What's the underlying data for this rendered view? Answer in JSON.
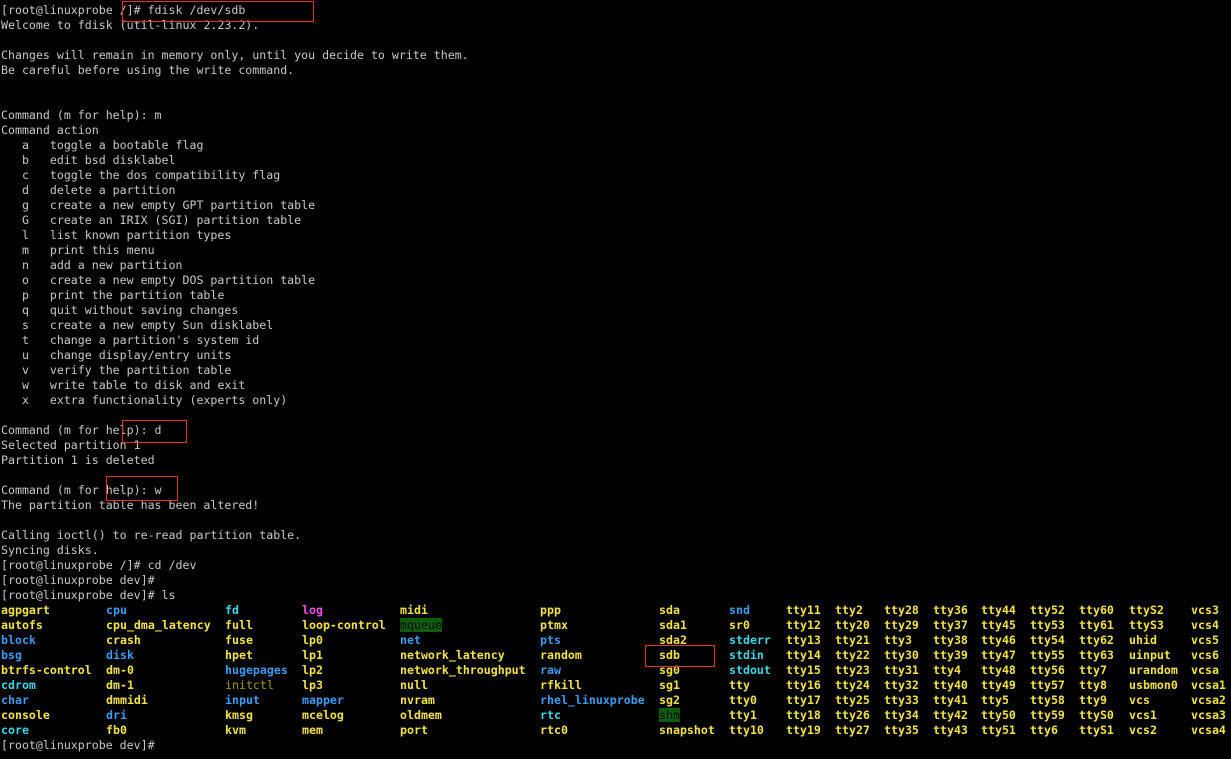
{
  "terminal": {
    "lines": [
      "[root@linuxprobe /]# fdisk /dev/sdb",
      "Welcome to fdisk (util-linux 2.23.2).",
      "",
      "Changes will remain in memory only, until you decide to write them.",
      "Be careful before using the write command.",
      "",
      "",
      "Command (m for help): m",
      "Command action",
      "   a   toggle a bootable flag",
      "   b   edit bsd disklabel",
      "   c   toggle the dos compatibility flag",
      "   d   delete a partition",
      "   g   create a new empty GPT partition table",
      "   G   create an IRIX (SGI) partition table",
      "   l   list known partition types",
      "   m   print this menu",
      "   n   add a new partition",
      "   o   create a new empty DOS partition table",
      "   p   print the partition table",
      "   q   quit without saving changes",
      "   s   create a new empty Sun disklabel",
      "   t   change a partition's system id",
      "   u   change display/entry units",
      "   v   verify the partition table",
      "   w   write table to disk and exit",
      "   x   extra functionality (experts only)",
      "",
      "Command (m for help): d",
      "Selected partition 1",
      "Partition 1 is deleted",
      "",
      "Command (m for help): w",
      "The partition table has been altered!",
      "",
      "Calling ioctl() to re-read partition table.",
      "Syncing disks.",
      "[root@linuxprobe /]# cd /dev",
      "[root@linuxprobe dev]#",
      "[root@linuxprobe dev]# ls"
    ],
    "final_prompt": "[root@linuxprobe dev]#",
    "ls_columns": [
      [
        [
          "agpgart",
          "dev"
        ],
        [
          "autofs",
          "dev"
        ],
        [
          "block",
          "dir"
        ],
        [
          "bsg",
          "dir"
        ],
        [
          "btrfs-control",
          "dev"
        ],
        [
          "cdrom",
          "link"
        ],
        [
          "char",
          "dir"
        ],
        [
          "console",
          "dev"
        ],
        [
          "core",
          "link"
        ]
      ],
      [
        [
          "cpu",
          "dir"
        ],
        [
          "cpu_dma_latency",
          "dev"
        ],
        [
          "crash",
          "dev"
        ],
        [
          "disk",
          "dir"
        ],
        [
          "dm-0",
          "dev"
        ],
        [
          "dm-1",
          "dev"
        ],
        [
          "dmmidi",
          "dev"
        ],
        [
          "dri",
          "dir"
        ],
        [
          "fb0",
          "dev"
        ]
      ],
      [
        [
          "fd",
          "link"
        ],
        [
          "full",
          "dev"
        ],
        [
          "fuse",
          "dev"
        ],
        [
          "hpet",
          "dev"
        ],
        [
          "hugepages",
          "dir"
        ],
        [
          "initctl",
          "pipe"
        ],
        [
          "input",
          "dir"
        ],
        [
          "kmsg",
          "dev"
        ],
        [
          "kvm",
          "dev"
        ]
      ],
      [
        [
          "log",
          "sock"
        ],
        [
          "loop-control",
          "dev"
        ],
        [
          "lp0",
          "dev"
        ],
        [
          "lp1",
          "dev"
        ],
        [
          "lp2",
          "dev"
        ],
        [
          "lp3",
          "dev"
        ],
        [
          "mapper",
          "dir"
        ],
        [
          "mcelog",
          "dev"
        ],
        [
          "mem",
          "dev"
        ]
      ],
      [
        [
          "midi",
          "dev"
        ],
        [
          "mqueue",
          "sticky"
        ],
        [
          "net",
          "dir"
        ],
        [
          "network_latency",
          "dev"
        ],
        [
          "network_throughput",
          "dev"
        ],
        [
          "null",
          "dev"
        ],
        [
          "nvram",
          "dev"
        ],
        [
          "oldmem",
          "dev"
        ],
        [
          "port",
          "dev"
        ]
      ],
      [
        [
          "ppp",
          "dev"
        ],
        [
          "ptmx",
          "dev"
        ],
        [
          "pts",
          "dir"
        ],
        [
          "random",
          "dev"
        ],
        [
          "raw",
          "dir"
        ],
        [
          "rfkill",
          "dev"
        ],
        [
          "rhel_linuxprobe",
          "dir"
        ],
        [
          "rtc",
          "link"
        ],
        [
          "rtc0",
          "dev"
        ]
      ],
      [
        [
          "sda",
          "dev"
        ],
        [
          "sda1",
          "dev"
        ],
        [
          "sda2",
          "dev"
        ],
        [
          "sdb",
          "dev"
        ],
        [
          "sg0",
          "dev"
        ],
        [
          "sg1",
          "dev"
        ],
        [
          "sg2",
          "dev"
        ],
        [
          "shm",
          "sticky"
        ],
        [
          "snapshot",
          "dev"
        ]
      ],
      [
        [
          "snd",
          "dir"
        ],
        [
          "sr0",
          "dev"
        ],
        [
          "stderr",
          "link"
        ],
        [
          "stdin",
          "link"
        ],
        [
          "stdout",
          "link"
        ],
        [
          "tty",
          "dev"
        ],
        [
          "tty0",
          "dev"
        ],
        [
          "tty1",
          "dev"
        ],
        [
          "tty10",
          "dev"
        ]
      ],
      [
        [
          "tty11",
          "dev"
        ],
        [
          "tty12",
          "dev"
        ],
        [
          "tty13",
          "dev"
        ],
        [
          "tty14",
          "dev"
        ],
        [
          "tty15",
          "dev"
        ],
        [
          "tty16",
          "dev"
        ],
        [
          "tty17",
          "dev"
        ],
        [
          "tty18",
          "dev"
        ],
        [
          "tty19",
          "dev"
        ]
      ],
      [
        [
          "tty2",
          "dev"
        ],
        [
          "tty20",
          "dev"
        ],
        [
          "tty21",
          "dev"
        ],
        [
          "tty22",
          "dev"
        ],
        [
          "tty23",
          "dev"
        ],
        [
          "tty24",
          "dev"
        ],
        [
          "tty25",
          "dev"
        ],
        [
          "tty26",
          "dev"
        ],
        [
          "tty27",
          "dev"
        ]
      ],
      [
        [
          "tty28",
          "dev"
        ],
        [
          "tty29",
          "dev"
        ],
        [
          "tty3",
          "dev"
        ],
        [
          "tty30",
          "dev"
        ],
        [
          "tty31",
          "dev"
        ],
        [
          "tty32",
          "dev"
        ],
        [
          "tty33",
          "dev"
        ],
        [
          "tty34",
          "dev"
        ],
        [
          "tty35",
          "dev"
        ]
      ],
      [
        [
          "tty36",
          "dev"
        ],
        [
          "tty37",
          "dev"
        ],
        [
          "tty38",
          "dev"
        ],
        [
          "tty39",
          "dev"
        ],
        [
          "tty4",
          "dev"
        ],
        [
          "tty40",
          "dev"
        ],
        [
          "tty41",
          "dev"
        ],
        [
          "tty42",
          "dev"
        ],
        [
          "tty43",
          "dev"
        ]
      ],
      [
        [
          "tty44",
          "dev"
        ],
        [
          "tty45",
          "dev"
        ],
        [
          "tty46",
          "dev"
        ],
        [
          "tty47",
          "dev"
        ],
        [
          "tty48",
          "dev"
        ],
        [
          "tty49",
          "dev"
        ],
        [
          "tty5",
          "dev"
        ],
        [
          "tty50",
          "dev"
        ],
        [
          "tty51",
          "dev"
        ]
      ],
      [
        [
          "tty52",
          "dev"
        ],
        [
          "tty53",
          "dev"
        ],
        [
          "tty54",
          "dev"
        ],
        [
          "tty55",
          "dev"
        ],
        [
          "tty56",
          "dev"
        ],
        [
          "tty57",
          "dev"
        ],
        [
          "tty58",
          "dev"
        ],
        [
          "tty59",
          "dev"
        ],
        [
          "tty6",
          "dev"
        ]
      ],
      [
        [
          "tty60",
          "dev"
        ],
        [
          "tty61",
          "dev"
        ],
        [
          "tty62",
          "dev"
        ],
        [
          "tty63",
          "dev"
        ],
        [
          "tty7",
          "dev"
        ],
        [
          "tty8",
          "dev"
        ],
        [
          "tty9",
          "dev"
        ],
        [
          "ttyS0",
          "dev"
        ],
        [
          "ttyS1",
          "dev"
        ]
      ],
      [
        [
          "ttyS2",
          "dev"
        ],
        [
          "ttyS3",
          "dev"
        ],
        [
          "uhid",
          "dev"
        ],
        [
          "uinput",
          "dev"
        ],
        [
          "urandom",
          "dev"
        ],
        [
          "usbmon0",
          "dev"
        ],
        [
          "vcs",
          "dev"
        ],
        [
          "vcs1",
          "dev"
        ],
        [
          "vcs2",
          "dev"
        ]
      ],
      [
        [
          "vcs3",
          "dev"
        ],
        [
          "vcs4",
          "dev"
        ],
        [
          "vcs5",
          "dev"
        ],
        [
          "vcs6",
          "dev"
        ],
        [
          "vcsa",
          "dev"
        ],
        [
          "vcsa1",
          "dev"
        ],
        [
          "vcsa2",
          "dev"
        ],
        [
          "vcsa3",
          "dev"
        ],
        [
          "vcsa4",
          "dev"
        ]
      ]
    ]
  },
  "colors": {
    "background": "#000000",
    "text": "#c8c8c8",
    "device": "#f2e24a",
    "directory": "#3c9cf2",
    "symlink": "#3ed6e6",
    "socket": "#f050f0",
    "sticky_bg": "#0b5c0b",
    "highlight_box": "#e03030"
  }
}
